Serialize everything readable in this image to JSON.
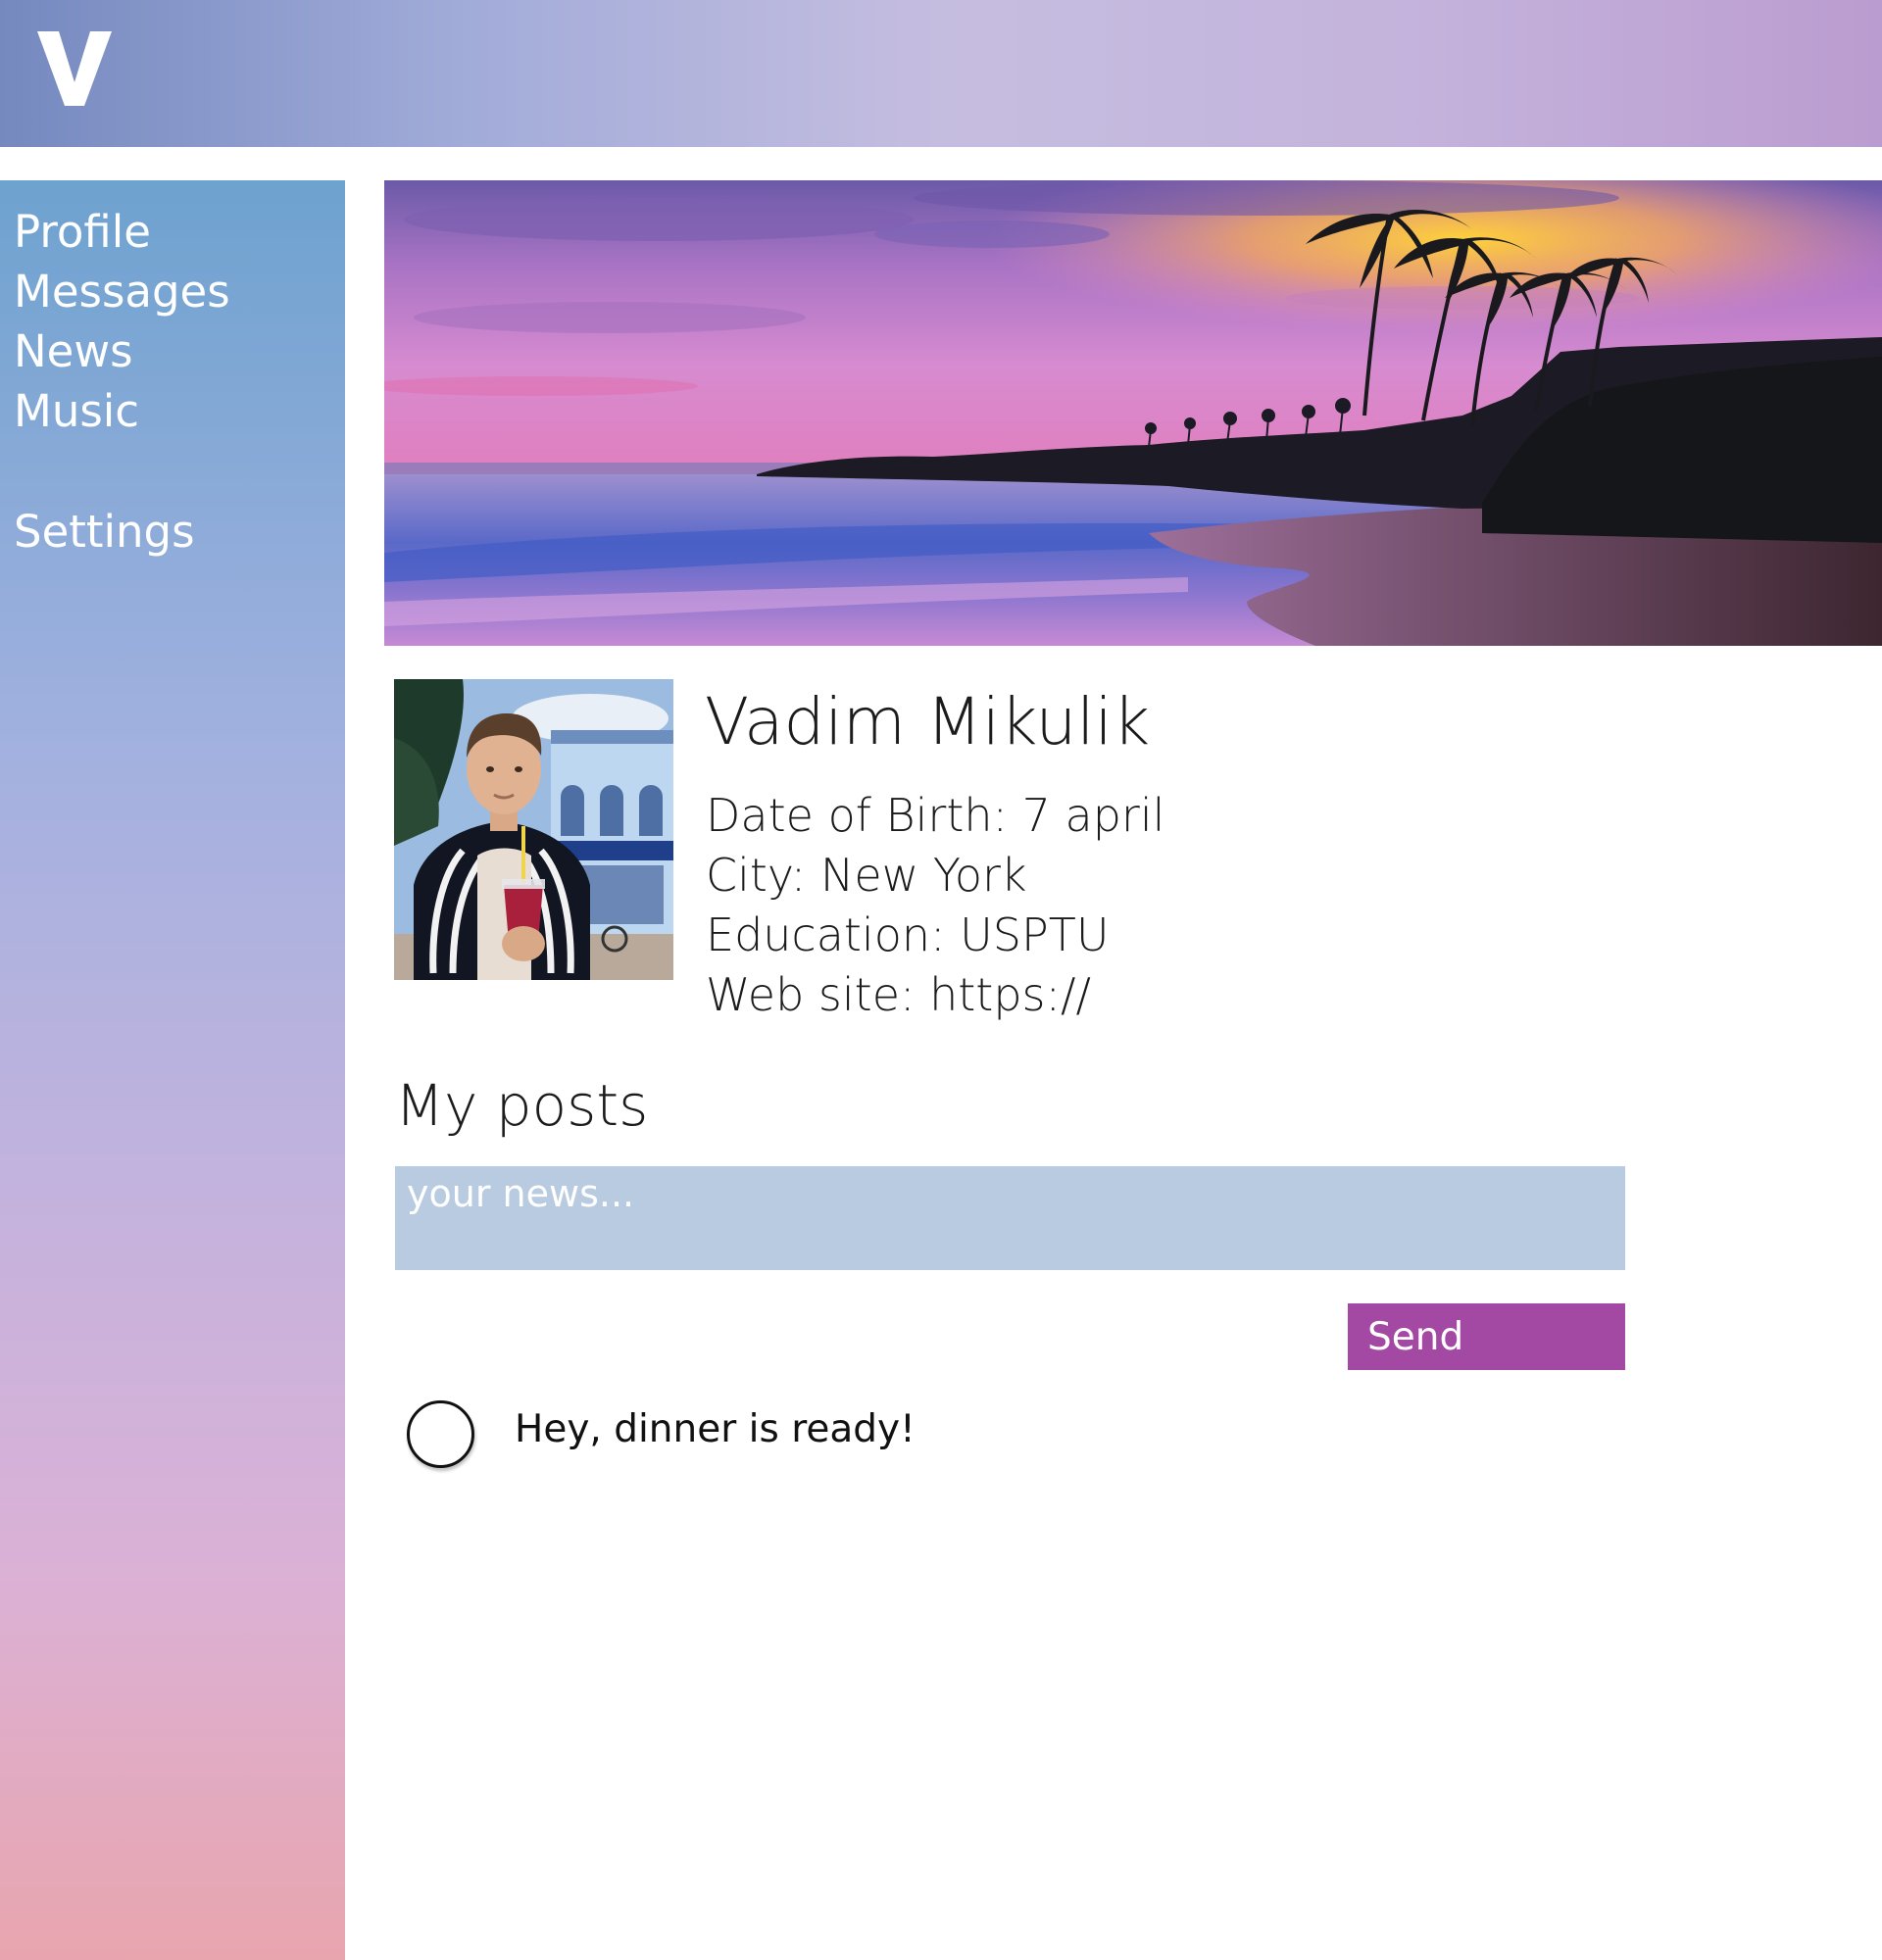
{
  "header": {
    "logo_icon": "v-logo-icon",
    "logo_text": "V"
  },
  "sidebar": {
    "items": [
      {
        "label": "Profile"
      },
      {
        "label": "Messages"
      },
      {
        "label": "News"
      },
      {
        "label": "Music"
      },
      {
        "label": "Settings"
      }
    ]
  },
  "banner": {
    "image": "tropical-beach-sunset-banner"
  },
  "profile": {
    "avatar": "profile-photo",
    "name": "Vadim Mikulik",
    "date_of_birth": "Date of Birth: 7 april",
    "city": "City: New York",
    "education": "Education: USPTU",
    "website": "Web site: https://"
  },
  "posts": {
    "title": "My posts",
    "input_placeholder": "your news...",
    "input_value": "",
    "send_label": "Send",
    "items": [
      {
        "avatar": "post-avatar-icon",
        "text": "Hey, dinner is ready!"
      }
    ]
  },
  "colors": {
    "send_button": "#a349a4",
    "input_background": "#b9cbe0",
    "sidebar_top": "#6ea2cf",
    "sidebar_bottom": "#e8a5ae",
    "header_left": "#7589bf",
    "header_right": "#bb9cd0"
  }
}
